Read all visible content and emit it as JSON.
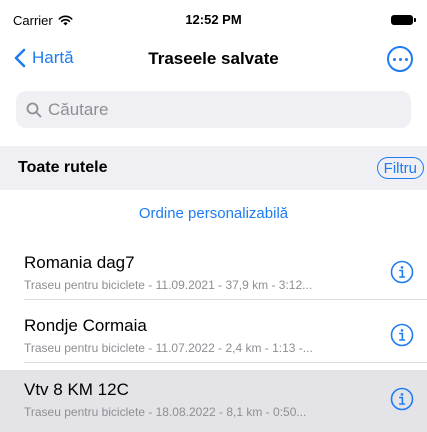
{
  "status_bar": {
    "carrier": "Carrier",
    "time": "12:52 PM",
    "icons": [
      "wifi-icon",
      "battery-icon"
    ]
  },
  "nav": {
    "back_label": "Hartă",
    "title": "Traseele salvate",
    "more_icon": "ellipsis-circle-icon"
  },
  "search": {
    "placeholder": "Căutare",
    "value": ""
  },
  "section": {
    "title": "Toate rutele",
    "filter_label": "Filtru"
  },
  "custom_order_label": "Ordine personalizabilă",
  "routes": [
    {
      "name": "Romania dag7",
      "meta": "Traseu pentru biciclete - 11.09.2021 - 37,9 km - 3:12...",
      "selected": false
    },
    {
      "name": "Rondje Cormaia",
      "meta": "Traseu pentru biciclete - 11.07.2022 - 2,4 km - 1:13 -...",
      "selected": false
    },
    {
      "name": "Vtv 8 KM 12C",
      "meta": "Traseu pentru biciclete - 18.08.2022 - 8,1 km - 0:50...",
      "selected": true
    }
  ],
  "colors": {
    "accent": "#1d7cf2",
    "secondary_text": "#8e8e93",
    "section_bg": "#efeff4",
    "selected_row_bg": "#e4e4e8"
  }
}
